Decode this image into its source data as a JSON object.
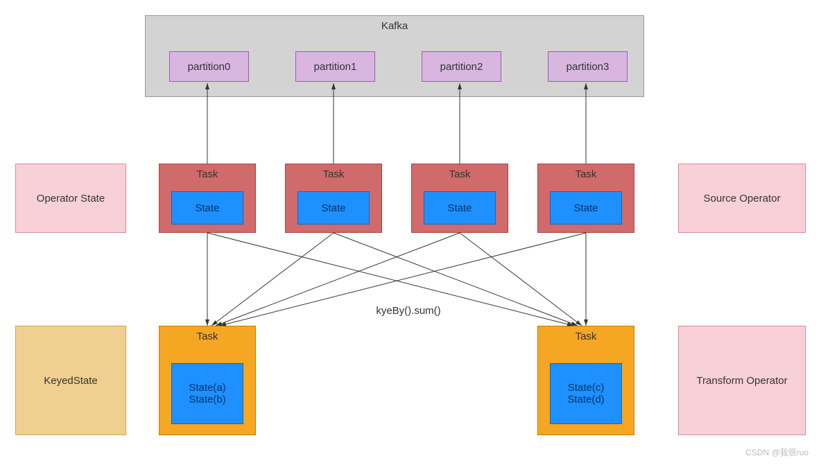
{
  "kafka": {
    "title": "Kafka",
    "partitions": [
      "partition0",
      "partition1",
      "partition2",
      "partition3"
    ]
  },
  "source_row": {
    "task_label": "Task",
    "state_label": "State"
  },
  "transform_row": {
    "task_label": "Task",
    "left_states": [
      "State(a)",
      "State(b)"
    ],
    "right_states": [
      "State(c)",
      "State(d)"
    ]
  },
  "middle_label": "kyeBy().sum()",
  "left_panels": {
    "operator_state": "Operator State",
    "keyed_state": "KeyedState"
  },
  "right_panels": {
    "source_operator": "Source Operator",
    "transform_operator": "Transform Operator"
  },
  "colors": {
    "kafka_bg": "#d3d3d3",
    "partition_bg": "#d8b6e0",
    "task_red_bg": "#d16a6a",
    "state_blue_bg": "#1e90ff",
    "task_orange_bg": "#f5a623",
    "panel_pink_bg": "#f8d0d8",
    "panel_tan_bg": "#f0d090"
  },
  "watermark": "CSDN @我很ruo",
  "chart_data": {
    "type": "diagram",
    "title": "Flink state model: Operator State vs KeyedState with Kafka source",
    "nodes": [
      {
        "id": "kafka",
        "label": "Kafka",
        "children": [
          "partition0",
          "partition1",
          "partition2",
          "partition3"
        ]
      },
      {
        "id": "src_task0",
        "label": "Task",
        "state": "State",
        "group": "Source Operator"
      },
      {
        "id": "src_task1",
        "label": "Task",
        "state": "State",
        "group": "Source Operator"
      },
      {
        "id": "src_task2",
        "label": "Task",
        "state": "State",
        "group": "Source Operator"
      },
      {
        "id": "src_task3",
        "label": "Task",
        "state": "State",
        "group": "Source Operator"
      },
      {
        "id": "tf_task_left",
        "label": "Task",
        "states": [
          "State(a)",
          "State(b)"
        ],
        "group": "Transform Operator"
      },
      {
        "id": "tf_task_right",
        "label": "Task",
        "states": [
          "State(c)",
          "State(d)"
        ],
        "group": "Transform Operator"
      }
    ],
    "edges": [
      {
        "from": "src_task0",
        "to": "partition0"
      },
      {
        "from": "src_task1",
        "to": "partition1"
      },
      {
        "from": "src_task2",
        "to": "partition2"
      },
      {
        "from": "src_task3",
        "to": "partition3"
      },
      {
        "from": "src_task0",
        "to": "tf_task_left",
        "label": "kyeBy().sum()"
      },
      {
        "from": "src_task1",
        "to": "tf_task_left"
      },
      {
        "from": "src_task2",
        "to": "tf_task_left"
      },
      {
        "from": "src_task3",
        "to": "tf_task_left"
      },
      {
        "from": "src_task0",
        "to": "tf_task_right"
      },
      {
        "from": "src_task1",
        "to": "tf_task_right"
      },
      {
        "from": "src_task2",
        "to": "tf_task_right"
      },
      {
        "from": "src_task3",
        "to": "tf_task_right"
      }
    ],
    "row_labels": {
      "source_row": "Operator State",
      "transform_row": "KeyedState"
    }
  }
}
